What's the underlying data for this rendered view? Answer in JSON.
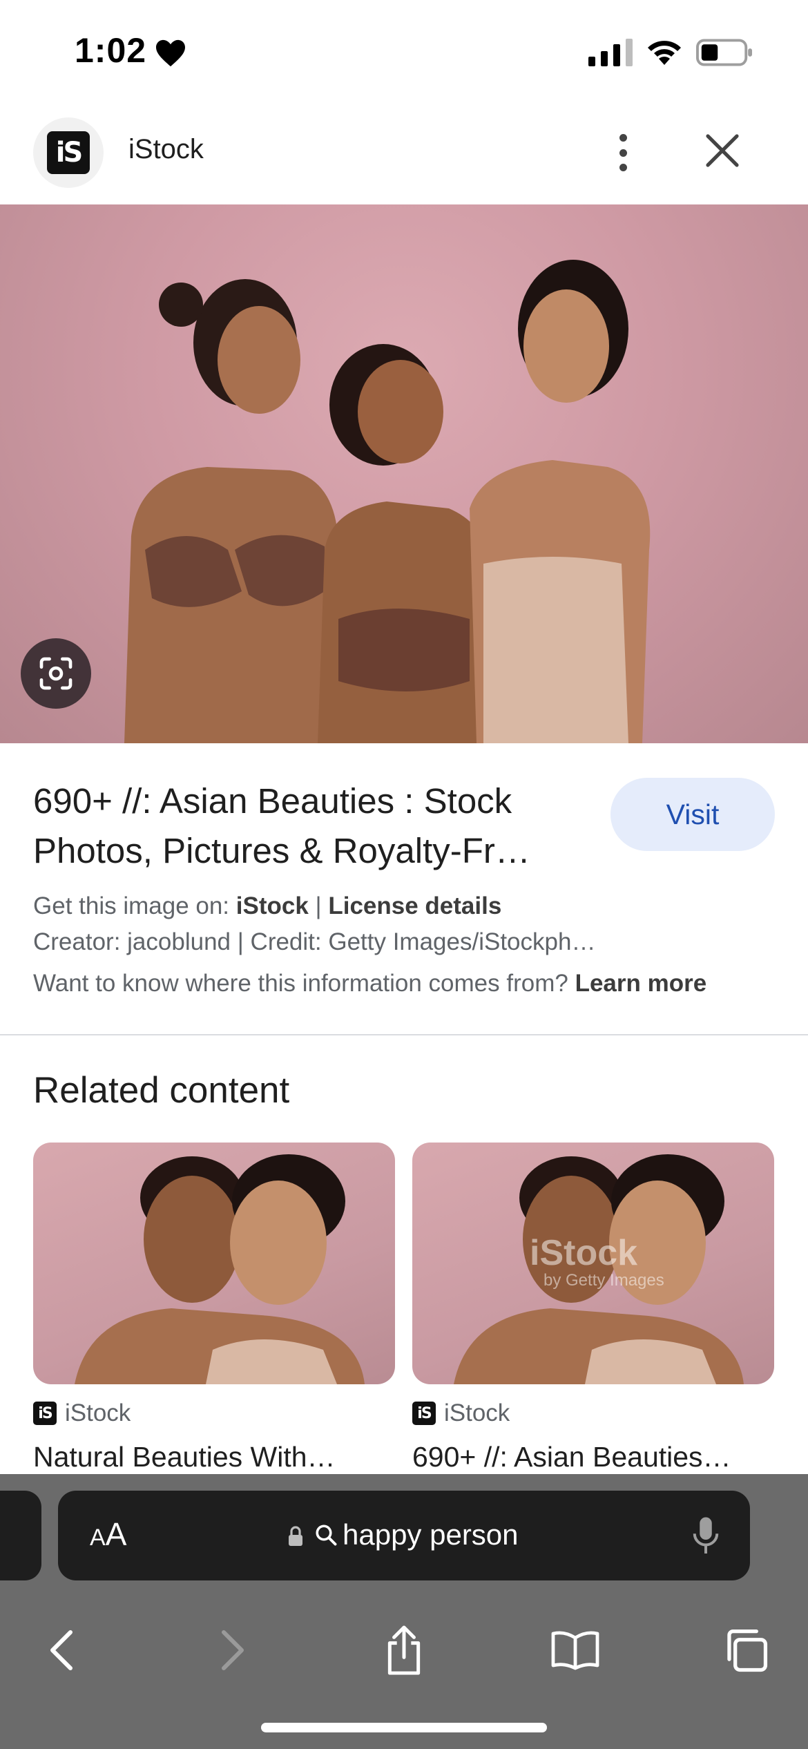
{
  "status_bar": {
    "time": "1:02"
  },
  "header": {
    "site_name": "iStock",
    "logo_text": "iS"
  },
  "result": {
    "title": "690+ //: Asian Beauties : Stock Photos, Pictures & Royalty-Fr…",
    "visit_label": "Visit",
    "get_image_prefix": "Get this image on: ",
    "get_image_source": "iStock",
    "separator": " | ",
    "license_label": "License details",
    "credit_line": "Creator: jacoblund | Credit: Getty Images/iStockph…",
    "info_question": "Want to know where this information comes from? ",
    "learn_more_label": "Learn more"
  },
  "related": {
    "title": "Related content",
    "cards": [
      {
        "source": "iStock",
        "title": "Natural Beauties With…"
      },
      {
        "source": "iStock",
        "title": "690+ //: Asian Beauties…",
        "watermark": "iStock",
        "watermark_sub": "by Getty Images"
      }
    ]
  },
  "browser": {
    "aa_label_small": "A",
    "aa_label_large": "A",
    "address_text": "happy person"
  },
  "colors": {
    "visit_bg": "#e5ecfb",
    "visit_text": "#1f4fb0",
    "toolbar_bg": "#6b6b6b",
    "hero_bg": "#cf9aa4"
  }
}
